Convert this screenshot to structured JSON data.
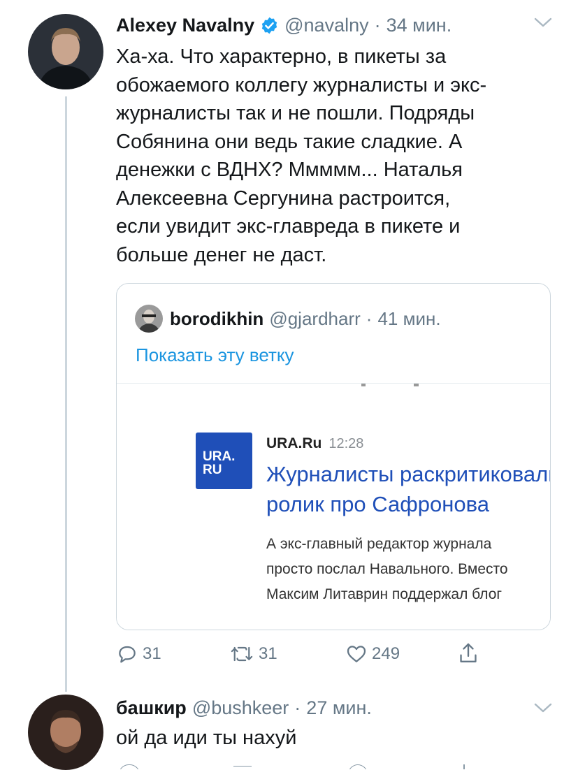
{
  "tweet": {
    "author_name": "Alexey Navalny",
    "handle": "@navalny",
    "sep": "·",
    "time": "34 мин.",
    "text_lines": [
      "Ха-ха. Что характерно, в пикеты за",
      "обожаемого коллегу журналисты и экс-",
      "журналисты так и не пошли. Подряды",
      "Собянина они ведь такие сладкие. А",
      "денежки с ВДНХ? Ммммм... Наталья",
      "Алексеевна Сергунина растроится,",
      "если увидит экс-главреда в пикете и",
      "больше денег не даст."
    ],
    "verified_icon": "verified-badge-icon",
    "accent_color": "#1da1f2"
  },
  "quote": {
    "author_name": "borodikhin",
    "handle": "@gjardharr",
    "sep": "·",
    "time": "41 мин.",
    "show_thread": "Показать эту ветку",
    "embed": {
      "logo_line1": "URA.",
      "logo_line2": "RU",
      "source": "URA.Ru",
      "time": "12:28",
      "headline_line1": "Журналисты раскритиковали",
      "headline_line2": "ролик про Сафронова",
      "snippet_lines": [
        "А экс-главный редактор журнала",
        "просто послал Навального. Вместо",
        "Максим Литаврин поддержал блог"
      ],
      "brand_color": "#1f4fb8"
    }
  },
  "actions": {
    "reply_count": "31",
    "retweet_count": "31",
    "like_count": "249"
  },
  "reply": {
    "author_name": "башкир",
    "handle": "@bushkeer",
    "sep": "·",
    "time": "27 мин.",
    "text": "ой да иди ты нахуй"
  }
}
